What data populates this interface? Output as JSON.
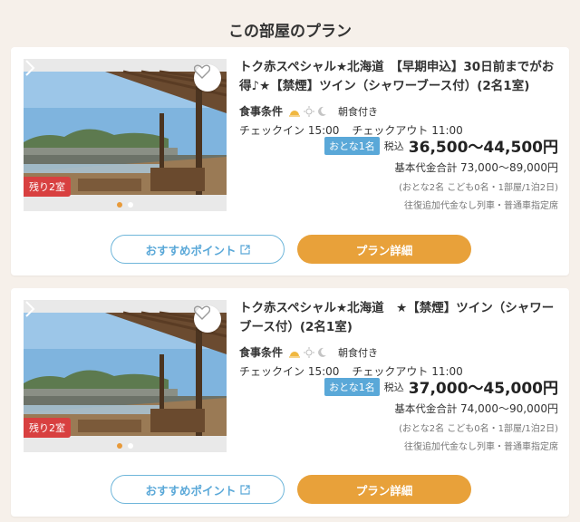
{
  "page": {
    "section_title": "この部屋のプラン"
  },
  "colors": {
    "accent_orange": "#e8a13a",
    "badge_blue": "#5aa8d8",
    "remain_red": "#d84040"
  },
  "plans": [
    {
      "title": "トク赤スペシャル★北海道　【早期申込】30日前までがお得♪★【禁煙】ツイン（シャワーブース付）(2名1室)",
      "meal_label": "食事条件",
      "meal_icons": [
        "morning-sun-icon",
        "day-sun-icon",
        "moon-icon"
      ],
      "meal_text": "朝食付き",
      "checkin": "チェックイン 15:00",
      "checkout": "チェックアウト 11:00",
      "guest_badge": "おとな1名",
      "tax_label": "税込",
      "price": "36,500〜44,500円",
      "total_label": "基本代金合計",
      "total_amount": "73,000〜89,000円",
      "sub_note": "(おとな2名 こども0名・1部屋/1泊2日)",
      "transport_note": "往復追加代金なし列車・普通車指定席",
      "remaining": "残り2室",
      "reco_label": "おすすめポイント",
      "detail_label": "プラン詳細"
    },
    {
      "title": "トク赤スペシャル★北海道　★【禁煙】ツイン（シャワーブース付）(2名1室)",
      "meal_label": "食事条件",
      "meal_icons": [
        "morning-sun-icon",
        "day-sun-icon",
        "moon-icon"
      ],
      "meal_text": "朝食付き",
      "checkin": "チェックイン 15:00",
      "checkout": "チェックアウト 11:00",
      "guest_badge": "おとな1名",
      "tax_label": "税込",
      "price": "37,000〜45,000円",
      "total_label": "基本代金合計",
      "total_amount": "74,000〜90,000円",
      "sub_note": "(おとな2名 こども0名・1部屋/1泊2日)",
      "transport_note": "往復追加代金なし列車・普通車指定席",
      "remaining": "残り2室",
      "reco_label": "おすすめポイント",
      "detail_label": "プラン詳細"
    }
  ]
}
